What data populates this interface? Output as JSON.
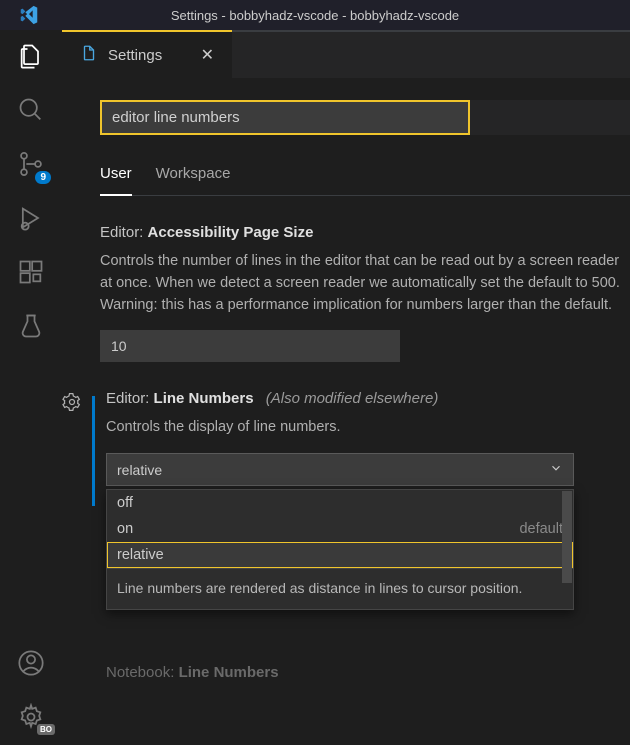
{
  "window_title": "Settings - bobbyhadz-vscode - bobbyhadz-vscode",
  "tab": {
    "title": "Settings"
  },
  "search": {
    "value": "editor line numbers"
  },
  "scope": {
    "user": "User",
    "workspace": "Workspace"
  },
  "activity": {
    "source_control_badge": "9",
    "settings_badge": "BO"
  },
  "settings": {
    "accessibility": {
      "category": "Editor:",
      "name": "Accessibility Page Size",
      "desc": "Controls the number of lines in the editor that can be read out by a screen reader at once. When we detect a screen reader we automatically set the default to 500. Warning: this has a performance implication for numbers larger than the default.",
      "value": "10"
    },
    "line_numbers": {
      "category": "Editor:",
      "name": "Line Numbers",
      "meta": "(Also modified elsewhere)",
      "desc": "Controls the display of line numbers.",
      "value": "relative",
      "options": [
        {
          "label": "off",
          "hint": ""
        },
        {
          "label": "on",
          "hint": "default"
        },
        {
          "label": "relative",
          "hint": ""
        }
      ],
      "selected_desc": "Line numbers are rendered as distance in lines to cursor position."
    },
    "notebook": {
      "category": "Notebook:",
      "name": "Line Numbers"
    }
  }
}
